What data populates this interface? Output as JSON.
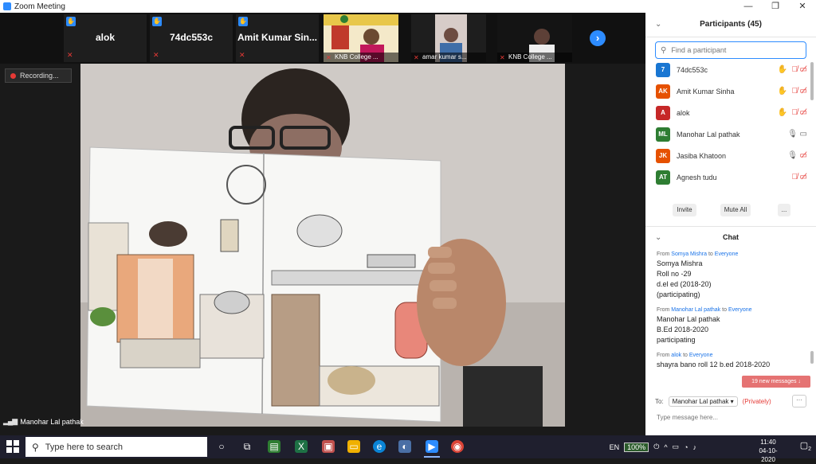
{
  "window": {
    "title": "Zoom Meeting",
    "controls": [
      "—",
      "❐",
      "✕"
    ]
  },
  "strip": {
    "name_tiles": [
      {
        "name": "alok"
      },
      {
        "name": "74dc553c"
      },
      {
        "name": "Amit Kumar Sin..."
      }
    ],
    "video_tiles": [
      {
        "caption": "KNB College ..."
      },
      {
        "caption": "amar kumar s..."
      },
      {
        "caption": "KNB College ..."
      }
    ],
    "next_symbol": "›"
  },
  "recording_label": "Recording...",
  "active_speaker": "Manohar Lal pathak",
  "participants": {
    "title": "Participants (45)",
    "search_placeholder": "Find a participant",
    "list": [
      {
        "initials": "7",
        "name": "74dc553c",
        "color": "#1976d2",
        "hand": true,
        "mic_on": false,
        "cam_on": false
      },
      {
        "initials": "AK",
        "name": "Amit Kumar Sinha",
        "color": "#e65100",
        "hand": true,
        "mic_on": false,
        "cam_on": false
      },
      {
        "initials": "A",
        "name": "alok",
        "color": "#c62828",
        "hand": true,
        "mic_on": false,
        "cam_on": false
      },
      {
        "initials": "ML",
        "name": "Manohar Lal pathak",
        "color": "#2e7d32",
        "hand": false,
        "mic_on": true,
        "cam_on": true
      },
      {
        "initials": "JK",
        "name": "Jasiba Khatoon",
        "color": "#e65100",
        "hand": false,
        "mic_on": true,
        "cam_on": false
      },
      {
        "initials": "AT",
        "name": "Agnesh tudu",
        "color": "#2e7d32",
        "hand": false,
        "mic_on": false,
        "cam_on": false
      }
    ],
    "invite_label": "Invite",
    "mute_all_label": "Mute All",
    "more_label": "..."
  },
  "chat": {
    "title": "Chat",
    "messages": [
      {
        "from": "Somya Mishra",
        "to": "Everyone",
        "lines": [
          "Somya Mishra",
          "Roll no -29",
          "d.el ed (2018-20)",
          "(participating)"
        ]
      },
      {
        "from": "Manohar Lal pathak",
        "to": "Everyone",
        "lines": [
          "Manohar Lal pathak",
          "B.Ed 2018-2020",
          "participating"
        ]
      },
      {
        "from": "alok",
        "to": "Everyone",
        "lines": [
          "shayra bano roll 12 b.ed 2018-2020"
        ]
      }
    ],
    "word_from": "From",
    "word_to": "to",
    "new_messages": "19 new messages ↓",
    "to_label": "To:",
    "recipient": "Manohar Lal pathak ▾",
    "privately": "(Privately)",
    "more": "···",
    "input_placeholder": "Type message here..."
  },
  "taskbar": {
    "search_placeholder": "Type here to search",
    "language": "EN",
    "battery": "100%",
    "time": "11:40",
    "date": "04-10-2020",
    "notifications": "2"
  }
}
